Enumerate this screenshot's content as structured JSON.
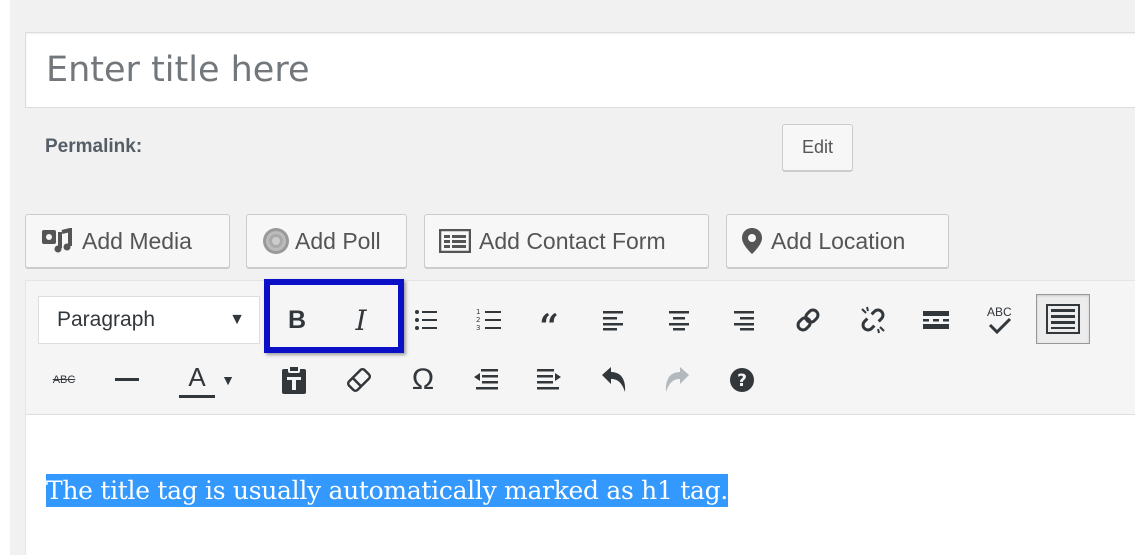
{
  "title": {
    "placeholder": "Enter title here"
  },
  "permalink": {
    "label": "Permalink:",
    "edit_label": "Edit"
  },
  "media_buttons": [
    {
      "label": "Add Media",
      "icon": "media-icon"
    },
    {
      "label": "Add Poll",
      "icon": "poll-icon"
    },
    {
      "label": "Add Contact Form",
      "icon": "form-icon"
    },
    {
      "label": "Add Location",
      "icon": "location-pin-icon"
    }
  ],
  "toolbar": {
    "format_selected": "Paragraph",
    "row1": [
      "bold",
      "italic",
      "bulleted-list",
      "numbered-list",
      "blockquote",
      "align-left",
      "align-center",
      "align-right",
      "insert-link",
      "remove-link",
      "read-more",
      "spellcheck",
      "toolbar-toggle"
    ],
    "row2": [
      "strikethrough",
      "horizontal-line",
      "text-color",
      "paste-as-text",
      "clear-formatting",
      "special-character",
      "decrease-indent",
      "increase-indent",
      "undo",
      "redo",
      "help"
    ],
    "bold_label": "B",
    "italic_label": "I",
    "text_color_label": "A",
    "omega_label": "Ω",
    "strike_label": "ABC",
    "spell_label": "ABC"
  },
  "highlight_color": "#0b10c7",
  "selection_color": "#3399ff",
  "content": {
    "selected_text": "The title tag is usually automatically marked as h1 tag."
  }
}
